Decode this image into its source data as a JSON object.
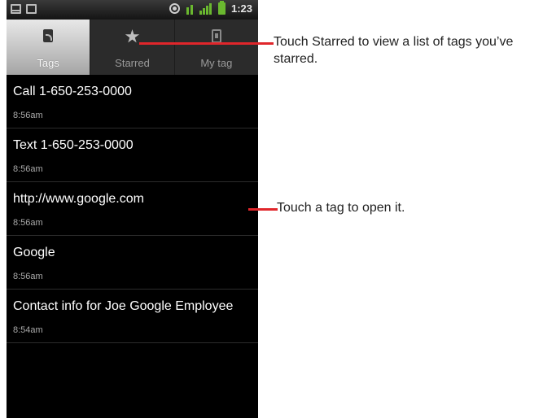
{
  "status_bar": {
    "time": "1:23"
  },
  "tabs": [
    {
      "label": "Tags",
      "icon": "tag-icon",
      "active": true
    },
    {
      "label": "Starred",
      "icon": "star-icon",
      "active": false
    },
    {
      "label": "My tag",
      "icon": "my-tag-icon",
      "active": false
    }
  ],
  "tags": [
    {
      "title": "Call 1-650-253-0000",
      "time": "8:56am"
    },
    {
      "title": "Text 1-650-253-0000",
      "time": "8:56am"
    },
    {
      "title": "http://www.google.com",
      "time": "8:56am"
    },
    {
      "title": "Google",
      "time": "8:56am"
    },
    {
      "title": "Contact info for Joe Google Employee",
      "time": "8:54am"
    }
  ],
  "callouts": {
    "starred": "Touch Starred to view a list of tags you’ve starred.",
    "open_tag": "Touch a tag to open it."
  },
  "colors": {
    "callout_line": "#e0262b",
    "signal": "#6ab82f"
  }
}
